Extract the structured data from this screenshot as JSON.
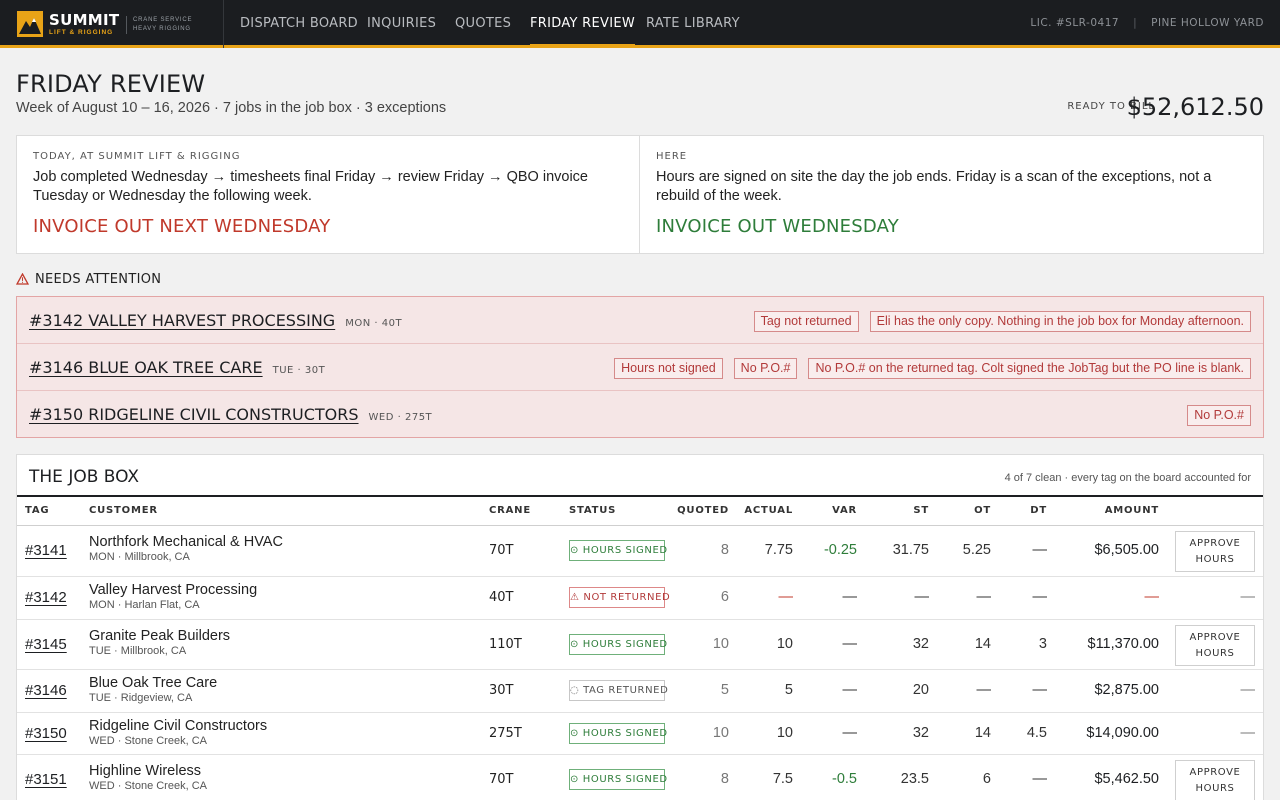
{
  "app": {
    "brand_name": "SUMMIT",
    "brand_sub": "LIFT & RIGGING",
    "brand_tag_1": "CRANE SERVICE",
    "brand_tag_2": "HEAVY RIGGING",
    "license": "LIC. #SLR-0417",
    "yard": "PINE HOLLOW YARD"
  },
  "nav": {
    "items": [
      {
        "label": "DISPATCH BOARD"
      },
      {
        "label": "INQUIRIES"
      },
      {
        "label": "QUOTES"
      },
      {
        "label": "FRIDAY REVIEW"
      },
      {
        "label": "RATE LIBRARY"
      }
    ],
    "active": "FRIDAY REVIEW"
  },
  "header": {
    "title": "FRIDAY REVIEW",
    "subtitle": "Week of August 10 – 16, 2026 · 7 jobs in the job box · 3 exceptions",
    "bill_label": "READY TO BILL",
    "bill_amount": "$52,612.50"
  },
  "compare": {
    "left": {
      "label": "TODAY, AT SUMMIT LIFT & RIGGING",
      "text": "Job completed Wednesday → timesheets final Friday → review Friday → QBO invoice Tuesday or Wednesday the following week.",
      "result": "INVOICE OUT NEXT WEDNESDAY"
    },
    "right": {
      "label": "HERE",
      "text": "Hours are signed on site the day the job ends. Friday is a scan of the exceptions, not a rebuild of the week.",
      "result": "INVOICE OUT WEDNESDAY"
    }
  },
  "attention": {
    "heading": "NEEDS ATTENTION",
    "rows": [
      {
        "title": "#3142 VALLEY HARVEST PROCESSING",
        "meta": "MON · 40T",
        "chips": [
          "Tag not returned",
          "Eli has the only copy. Nothing in the job box for Monday afternoon."
        ]
      },
      {
        "title": "#3146 BLUE OAK TREE CARE",
        "meta": "TUE · 30T",
        "chips": [
          "Hours not signed",
          "No P.O.#",
          "No P.O.# on the returned tag. Colt signed the JobTag but the PO line is blank."
        ]
      },
      {
        "title": "#3150 RIDGELINE CIVIL CONSTRUCTORS",
        "meta": "WED · 275T",
        "chips": [
          "No P.O.#"
        ]
      }
    ]
  },
  "jobbox": {
    "title": "THE JOB BOX",
    "note": "4 of 7 clean · every tag on the board accounted for",
    "columns": [
      "TAG",
      "CUSTOMER",
      "CRANE",
      "STATUS",
      "QUOTED",
      "ACTUAL",
      "VAR",
      "ST",
      "OT",
      "DT",
      "AMOUNT"
    ],
    "approve_label_1": "APPROVE",
    "approve_label_2": "HOURS",
    "rows": [
      {
        "tag": "#3141",
        "customer": "Northfork Mechanical & HVAC",
        "sub": "MON · Millbrook, CA",
        "crane": "70T",
        "status": "HOURS SIGNED",
        "status_kind": "signed",
        "quoted": "8",
        "actual": "7.75",
        "var": "-0.25",
        "st": "31.75",
        "ot": "5.25",
        "dt": "—",
        "amount": "$6,505.00",
        "approve": true
      },
      {
        "tag": "#3142",
        "customer": "Valley Harvest Processing",
        "sub": "MON · Harlan Flat, CA",
        "crane": "40T",
        "status": "NOT RETURNED",
        "status_kind": "notret",
        "quoted": "6",
        "actual": "—",
        "var": "—",
        "st": "—",
        "ot": "—",
        "dt": "—",
        "amount": "—",
        "approve": false,
        "end": "—"
      },
      {
        "tag": "#3145",
        "customer": "Granite Peak Builders",
        "sub": "TUE · Millbrook, CA",
        "crane": "110T",
        "status": "HOURS SIGNED",
        "status_kind": "signed",
        "quoted": "10",
        "actual": "10",
        "var": "—",
        "st": "32",
        "ot": "14",
        "dt": "3",
        "amount": "$11,370.00",
        "approve": true
      },
      {
        "tag": "#3146",
        "customer": "Blue Oak Tree Care",
        "sub": "TUE · Ridgeview, CA",
        "crane": "30T",
        "status": "TAG RETURNED",
        "status_kind": "returned",
        "quoted": "5",
        "actual": "5",
        "var": "—",
        "st": "20",
        "ot": "—",
        "dt": "—",
        "amount": "$2,875.00",
        "approve": false,
        "end": "—"
      },
      {
        "tag": "#3150",
        "customer": "Ridgeline Civil Constructors",
        "sub": "WED · Stone Creek, CA",
        "crane": "275T",
        "status": "HOURS SIGNED",
        "status_kind": "signed",
        "quoted": "10",
        "actual": "10",
        "var": "—",
        "st": "32",
        "ot": "14",
        "dt": "4.5",
        "amount": "$14,090.00",
        "approve": false,
        "end": "—"
      },
      {
        "tag": "#3151",
        "customer": "Highline Wireless",
        "sub": "WED · Stone Creek, CA",
        "crane": "70T",
        "status": "HOURS SIGNED",
        "status_kind": "signed",
        "quoted": "8",
        "actual": "7.5",
        "var": "-0.5",
        "st": "23.5",
        "ot": "6",
        "dt": "—",
        "amount": "$5,462.50",
        "approve": true
      }
    ]
  },
  "colors": {
    "accent": "#e8a317",
    "topbar": "#1b1d20",
    "alert": "#c0392b",
    "ok": "#2e7d3a"
  }
}
